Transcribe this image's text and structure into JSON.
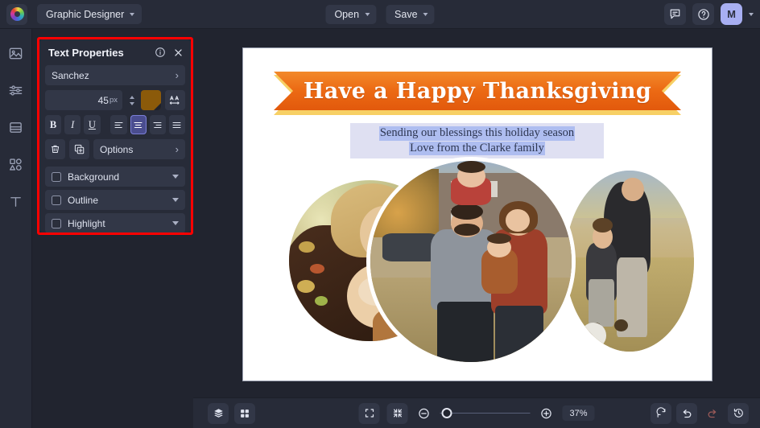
{
  "app": {
    "logo": "colorwheel-logo",
    "document_name": "Graphic Designer"
  },
  "topbar": {
    "open_label": "Open",
    "save_label": "Save",
    "feedback_icon": "comment-icon",
    "help_icon": "help-circle-icon",
    "avatar_initial": "M"
  },
  "sidebar": {
    "items": [
      {
        "name": "sidebar-item-images",
        "icon": "image-icon"
      },
      {
        "name": "sidebar-item-adjustments",
        "icon": "sliders-icon"
      },
      {
        "name": "sidebar-item-layers",
        "icon": "layers-panel-icon"
      },
      {
        "name": "sidebar-item-elements",
        "icon": "shapes-icon"
      },
      {
        "name": "sidebar-item-text",
        "icon": "text-t-icon"
      }
    ]
  },
  "panel": {
    "title": "Text Properties",
    "info_icon": "info-circle-icon",
    "close_icon": "close-x-icon",
    "font_family": "Sanchez",
    "font_size": "45",
    "font_size_unit": "px",
    "font_color_hex": "#8B5A0A",
    "letter_spacing_icon": "letter-spacing-icon",
    "format_buttons": [
      {
        "name": "bold-button",
        "label": "B",
        "selected": false
      },
      {
        "name": "italic-button",
        "label": "I",
        "selected": false
      },
      {
        "name": "underline-button",
        "label": "U",
        "selected": false
      }
    ],
    "align_buttons": [
      {
        "name": "align-left-button",
        "selected": false
      },
      {
        "name": "align-center-button",
        "selected": true
      },
      {
        "name": "align-right-button",
        "selected": false
      },
      {
        "name": "align-justify-button",
        "selected": false
      }
    ],
    "delete_icon": "trash-icon",
    "duplicate_icon": "duplicate-icon",
    "options_label": "Options",
    "accordions": [
      {
        "label": "Background",
        "checked": false
      },
      {
        "label": "Outline",
        "checked": false
      },
      {
        "label": "Highlight",
        "checked": false
      }
    ],
    "highlight_outline_color": "#ff0000"
  },
  "canvas": {
    "banner_title": "Have a Happy Thanksgiving",
    "subtitle_line1": "Sending our blessings this holiday season",
    "subtitle_line2": "Love from the Clarke family",
    "banner_color": "#EC6A14",
    "banner_accent_color": "#F6C84A",
    "selection_highlight_color": "#AEBDF0",
    "photos": [
      {
        "name": "photo-left-mother-and-baby"
      },
      {
        "name": "photo-center-family-portrait"
      },
      {
        "name": "photo-right-parent-and-toddler"
      }
    ]
  },
  "bottombar": {
    "layers_icon": "layers-stack-icon",
    "grid_icon": "grid-view-icon",
    "fit_icon": "fit-to-screen-icon",
    "shrink_icon": "shrink-to-fit-icon",
    "zoom_out_icon": "zoom-out-icon",
    "zoom_in_icon": "zoom-in-icon",
    "zoom_level": "37%",
    "reset_icon": "reset-rotate-icon",
    "undo_icon": "undo-arrow-icon",
    "redo_icon": "redo-arrow-icon",
    "history_icon": "history-clock-icon"
  }
}
